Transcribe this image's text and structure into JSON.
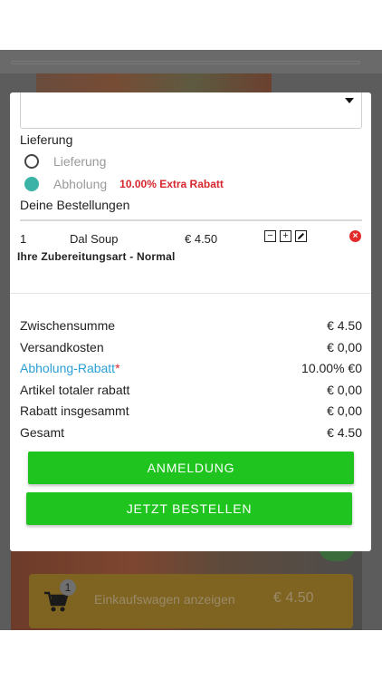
{
  "cart_bar": {
    "badge_count": "1",
    "label": "Einkaufswagen anzeigen",
    "total": "€ 4.50"
  },
  "delivery": {
    "section_label": "Lieferung",
    "options": [
      {
        "label": "Lieferung",
        "selected": false,
        "badge": ""
      },
      {
        "label": "Abholung",
        "selected": true,
        "badge": "10.00% Extra Rabatt"
      }
    ]
  },
  "orders": {
    "section_label": "Deine Bestellungen",
    "items": [
      {
        "qty": "1",
        "name": "Dal Soup",
        "price": "€ 4.50",
        "preparation": "Ihre Zubereitungsart - Normal"
      }
    ]
  },
  "summary": {
    "rows": [
      {
        "label": "Zwischensumme",
        "value": "€ 4.50"
      },
      {
        "label": "Versandkosten",
        "value": "€ 0,00"
      },
      {
        "label": "Abholung-Rabatt",
        "value": "10.00% €0",
        "asterisk": "*"
      },
      {
        "label": "Artikel totaler rabatt",
        "value": "€ 0,00"
      },
      {
        "label": "Rabatt insgesammt",
        "value": "€ 0,00"
      },
      {
        "label": "Gesamt",
        "value": "€ 4.50"
      }
    ]
  },
  "buttons": {
    "login": "ANMELDUNG",
    "order_now": "JETZT BESTELLEN"
  },
  "colors": {
    "accent_green": "#1fc41f",
    "radio_selected": "#3bb3a6",
    "discount_red": "#d6272d",
    "link_blue": "#2a9fd6"
  }
}
